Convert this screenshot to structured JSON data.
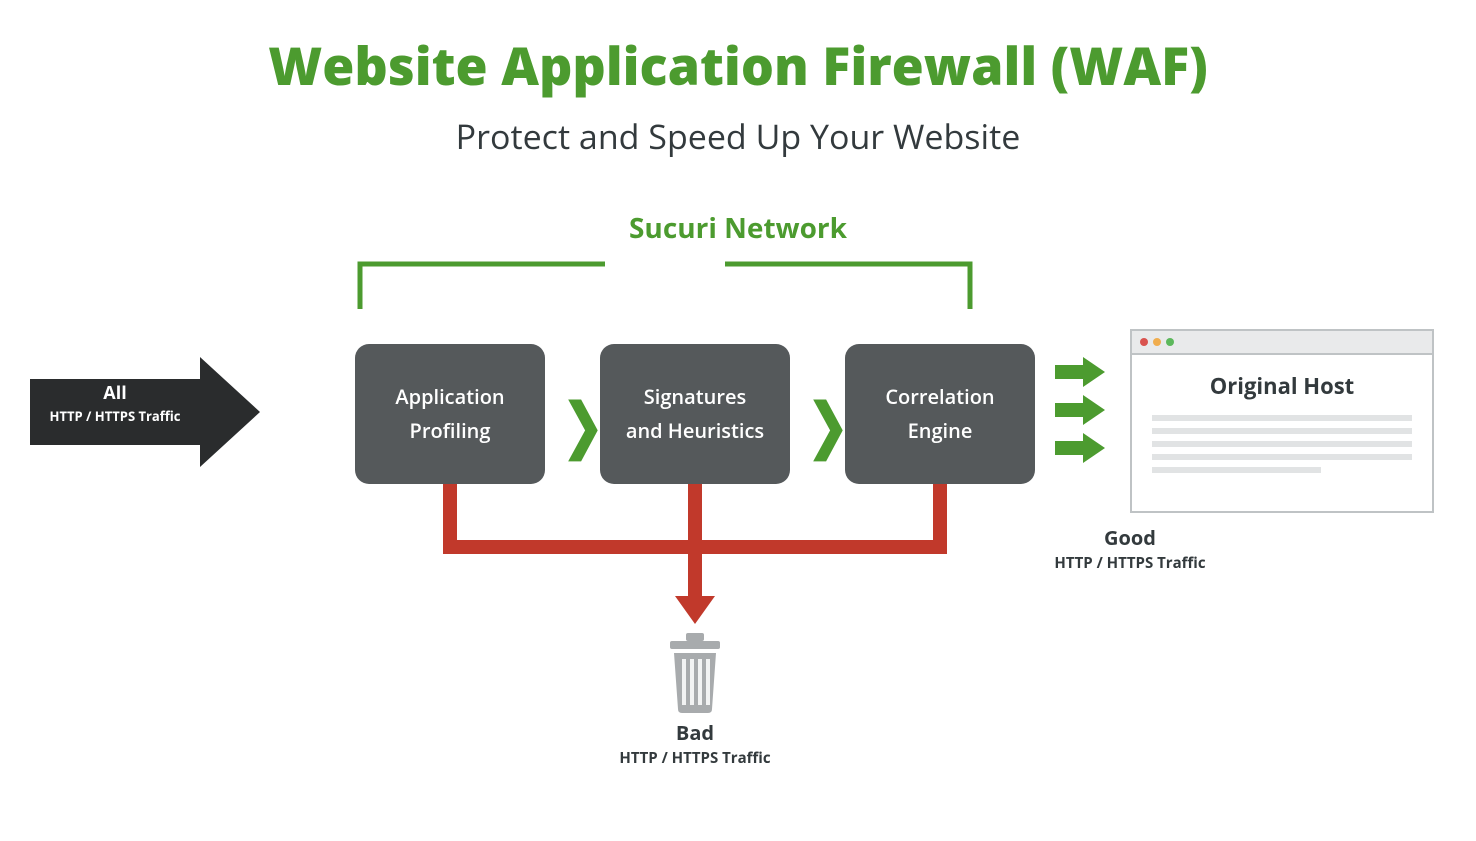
{
  "title": "Website Application Firewall (WAF)",
  "subtitle": "Protect and Speed Up Your Website",
  "network_label": "Sucuri Network",
  "incoming": {
    "line1": "All",
    "line2": "HTTP / HTTPS Traffic"
  },
  "nodes": [
    {
      "label": "Application\nProfiling"
    },
    {
      "label": "Signatures\nand Heuristics"
    },
    {
      "label": "Correlation\nEngine"
    }
  ],
  "good": {
    "line1": "Good",
    "line2": "HTTP / HTTPS Traffic"
  },
  "bad": {
    "line1": "Bad",
    "line2": "HTTP / HTTPS Traffic"
  },
  "host_label": "Original Host",
  "colors": {
    "green": "#4c9b2f",
    "darkgray": "#55595b",
    "red": "#c1392b",
    "black": "#2a2c2d"
  }
}
